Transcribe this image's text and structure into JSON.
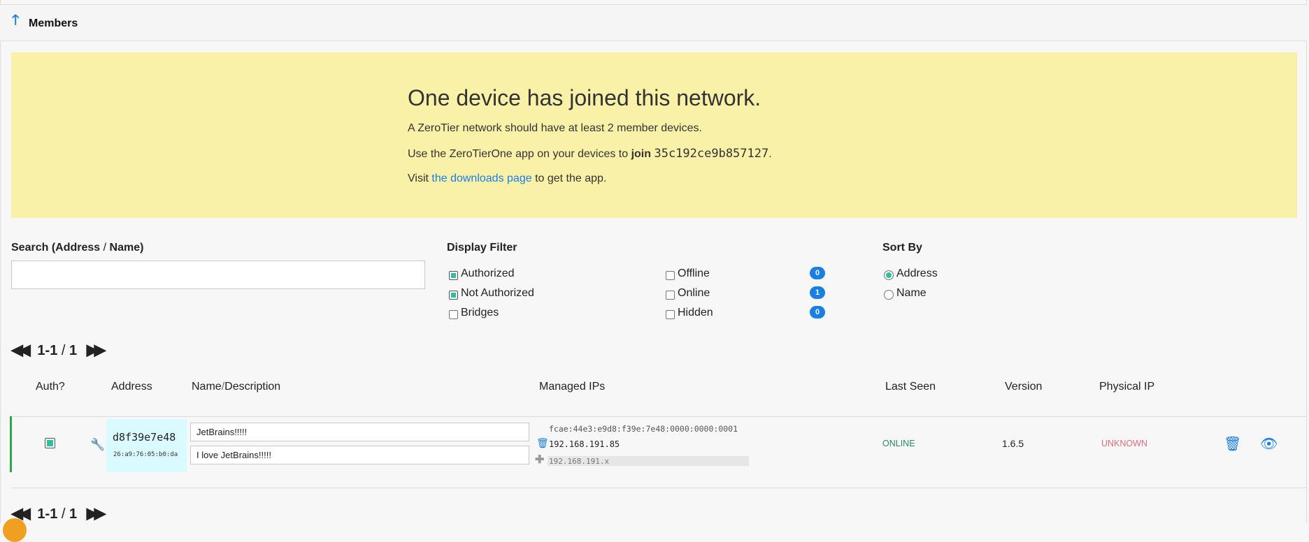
{
  "section": {
    "title": "Members"
  },
  "notice": {
    "headline": "One device has joined this network.",
    "line1": "A ZeroTier network should have at least 2 member devices.",
    "line2_prefix": "Use the ZeroTierOne app on your devices to",
    "line2_join": "join",
    "network_id": "35c192ce9b857127",
    "line2_suffix": ".",
    "line3_prefix": "Visit",
    "downloads_link": "the downloads page",
    "line3_suffix": "to get the app."
  },
  "search": {
    "label_a": "Search (Address",
    "label_slash": "/",
    "label_b": "Name)",
    "value": ""
  },
  "filter": {
    "label": "Display Filter",
    "options": [
      {
        "label": "Authorized",
        "checked": true
      },
      {
        "label": "Not Authorized",
        "checked": true
      },
      {
        "label": "Bridges",
        "checked": false
      },
      {
        "label": "Offline",
        "checked": false,
        "count": "0"
      },
      {
        "label": "Online",
        "checked": false,
        "count": "1"
      },
      {
        "label": "Hidden",
        "checked": false,
        "count": "0"
      }
    ]
  },
  "sort": {
    "label": "Sort By",
    "options": [
      {
        "label": "Address",
        "selected": true
      },
      {
        "label": "Name",
        "selected": false
      }
    ]
  },
  "pager": {
    "range": "1-1",
    "slash": "/",
    "total": "1"
  },
  "columns": {
    "auth": "Auth?",
    "address": "Address",
    "name_a": "Name",
    "name_slash": "/",
    "name_b": "Description",
    "managed_ips": "Managed IPs",
    "last_seen": "Last Seen",
    "version": "Version",
    "physical_ip": "Physical IP"
  },
  "member": {
    "authorized": true,
    "address": "d8f39e7e48",
    "mac": "26:a9:76:05:b0:da",
    "name": "JetBrains!!!!!",
    "description": "I love JetBrains!!!!!",
    "ipv6": "fcae:44e3:e9d8:f39e:7e48:0000:0000:0001",
    "ipv4": "192.168.191.85",
    "new_ip_placeholder": "192.168.191.x",
    "status": "ONLINE",
    "version": "1.6.5",
    "physical_ip": "UNKNOWN"
  },
  "icons": {
    "section": "arrow-up-icon",
    "settings": "wrench-icon",
    "remove_ip": "trash-icon",
    "add_ip": "plus-icon",
    "delete_member": "trash-icon",
    "hide_member": "eye-slash-icon",
    "pager_prev": "double-chevron-left-icon",
    "pager_next": "double-chevron-right-icon"
  },
  "colors": {
    "accent": "#1a7fe0",
    "notice_bg": "#faf1a9",
    "online": "#2c8a63",
    "unknown": "#e06c7c",
    "checked": "#2fbf9f"
  }
}
